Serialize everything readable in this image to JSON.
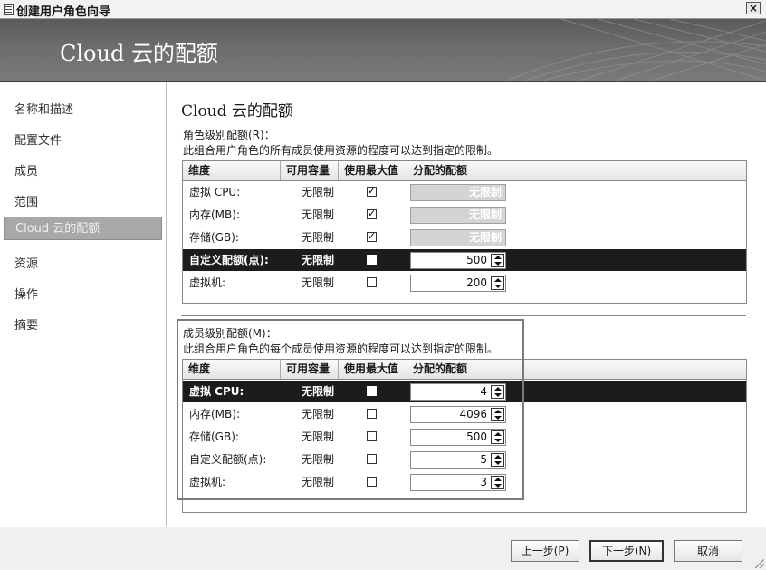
{
  "window": {
    "title": "创建用户角色向导"
  },
  "banner": {
    "title": "Cloud 云的配额"
  },
  "nav": {
    "items": [
      {
        "label": "名称和描述",
        "selected": false
      },
      {
        "label": "配置文件",
        "selected": false
      },
      {
        "label": "成员",
        "selected": false
      },
      {
        "label": "范围",
        "selected": false
      },
      {
        "label": "Cloud 云的配额",
        "selected": true
      },
      {
        "label": "资源",
        "selected": false
      },
      {
        "label": "操作",
        "selected": false
      },
      {
        "label": "摘要",
        "selected": false
      }
    ]
  },
  "main": {
    "heading": "Cloud 云的配额",
    "role_section": {
      "label": "角色级别配额(R)：",
      "description": "此组合用户角色的所有成员使用资源的程度可以达到指定的限制。",
      "columns": [
        "维度",
        "可用容量",
        "使用最大值",
        "分配的配额"
      ],
      "rows": [
        {
          "dimension": "虚拟 CPU:",
          "capacity": "无限制",
          "use_max": true,
          "quota": "无限制",
          "quota_disabled": true,
          "selected": false
        },
        {
          "dimension": "内存(MB):",
          "capacity": "无限制",
          "use_max": true,
          "quota": "无限制",
          "quota_disabled": true,
          "selected": false
        },
        {
          "dimension": "存储(GB):",
          "capacity": "无限制",
          "use_max": true,
          "quota": "无限制",
          "quota_disabled": true,
          "selected": false
        },
        {
          "dimension": "自定义配额(点):",
          "capacity": "无限制",
          "use_max": false,
          "quota": "500",
          "quota_disabled": false,
          "selected": true
        },
        {
          "dimension": "虚拟机:",
          "capacity": "无限制",
          "use_max": false,
          "quota": "200",
          "quota_disabled": false,
          "selected": false
        }
      ]
    },
    "member_section": {
      "label": "成员级别配额(M)：",
      "description": "此组合用户角色的每个成员使用资源的程度可以达到指定的限制。",
      "columns": [
        "维度",
        "可用容量",
        "使用最大值",
        "分配的配额"
      ],
      "rows": [
        {
          "dimension": "虚拟 CPU:",
          "capacity": "无限制",
          "use_max": false,
          "quota": "4",
          "quota_disabled": false,
          "selected": true
        },
        {
          "dimension": "内存(MB):",
          "capacity": "无限制",
          "use_max": false,
          "quota": "4096",
          "quota_disabled": false,
          "selected": false
        },
        {
          "dimension": "存储(GB):",
          "capacity": "无限制",
          "use_max": false,
          "quota": "500",
          "quota_disabled": false,
          "selected": false
        },
        {
          "dimension": "自定义配额(点):",
          "capacity": "无限制",
          "use_max": false,
          "quota": "5",
          "quota_disabled": false,
          "selected": false
        },
        {
          "dimension": "虚拟机:",
          "capacity": "无限制",
          "use_max": false,
          "quota": "3",
          "quota_disabled": false,
          "selected": false
        }
      ]
    }
  },
  "footer": {
    "prev": "上一步(P)",
    "next": "下一步(N)",
    "cancel": "取消"
  },
  "icons": {
    "window": "window-icon",
    "close": "close-icon",
    "spin": "spinner-arrows-icon",
    "grip": "resize-grip-icon"
  }
}
